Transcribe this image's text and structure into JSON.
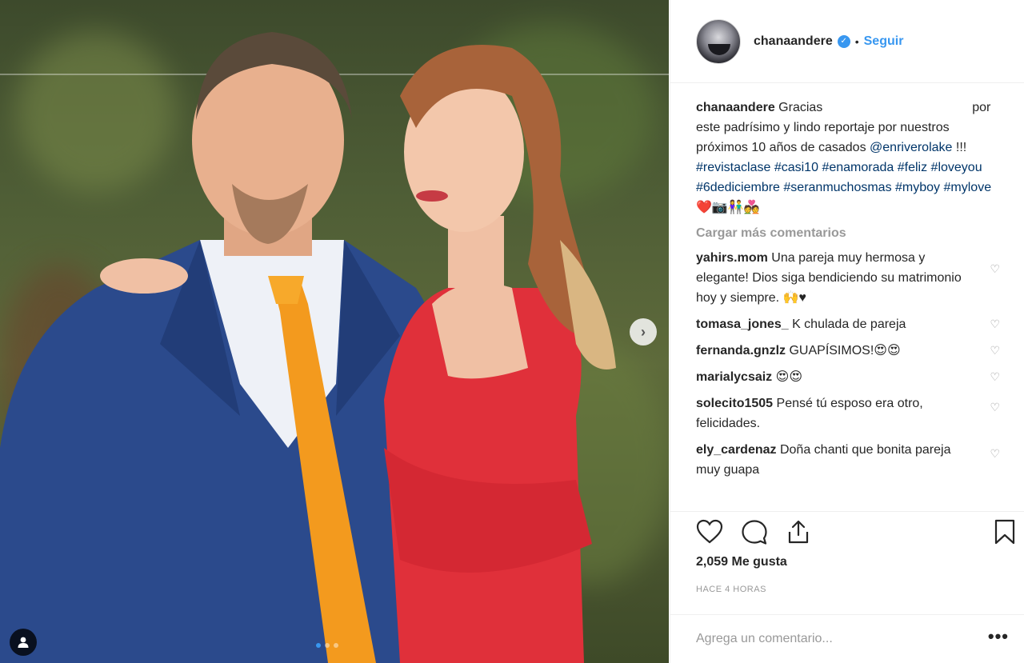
{
  "post": {
    "username": "chanaandere",
    "separator": "•",
    "follow_label": "Seguir",
    "caption": {
      "username": "chanaandere",
      "text_before": "Gracias",
      "text_after": "por este padrísimo y lindo reportaje por nuestros próximos 10 años de casados",
      "mention": "@enriverolake",
      "exclaim": "!!!",
      "hashtags": [
        "#revistaclase",
        "#casi10",
        "#enamorada",
        "#feliz",
        "#loveyou",
        "#6dediciembre",
        "#seranmuchosmas",
        "#myboy",
        "#mylove"
      ],
      "emojis": "❤️📷👫💑"
    },
    "load_more_label": "Cargar más comentarios",
    "comments": [
      {
        "username": "yahirs.mom",
        "text": "Una pareja muy hermosa y elegante! Dios siga bendiciendo su matrimonio hoy y siempre. 🙌♥"
      },
      {
        "username": "tomasa_jones_",
        "text": "K chulada de pareja"
      },
      {
        "username": "fernanda.gnzlz",
        "text": "GUAPÍSIMOS!😍😍"
      },
      {
        "username": "marialycsaiz",
        "text": "😍😍"
      },
      {
        "username": "solecito1505",
        "text": "Pensé tú esposo era otro, felicidades."
      },
      {
        "username": "ely_cardenaz",
        "text": "Doña chanti que bonita pareja muy guapa"
      }
    ],
    "likes_label": "2,059 Me gusta",
    "time_label": "HACE 4 HORAS",
    "comment_placeholder": "Agrega un comentario...",
    "options_label": "•••"
  },
  "carousel": {
    "count": 3,
    "current": 1
  },
  "colors": {
    "link": "#3897f0",
    "hashtag": "#003569",
    "dress": "#e0303a",
    "suit": "#2b4a8c",
    "tie": "#f39a1e"
  }
}
